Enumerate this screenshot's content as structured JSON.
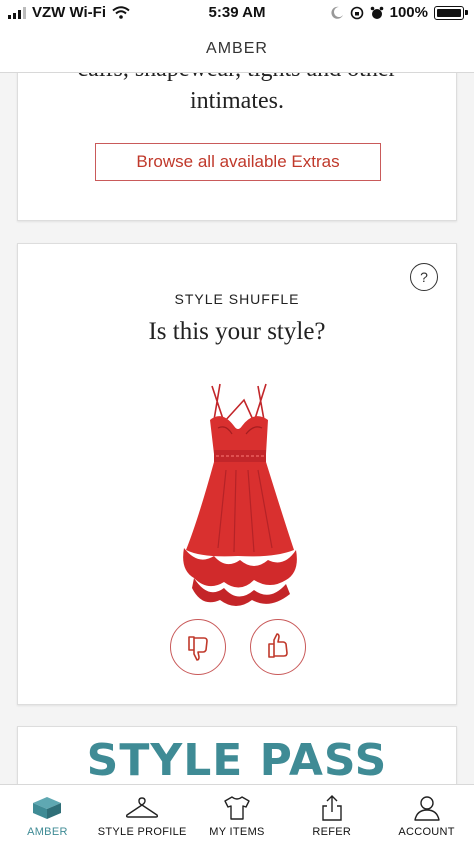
{
  "status_bar": {
    "carrier": "VZW Wi-Fi",
    "time": "5:39 AM",
    "battery": "100%"
  },
  "header": {
    "title": "AMBER"
  },
  "extras_card": {
    "text_line1": "calfs, shapewear, tights and other",
    "text_line2": "intimates.",
    "browse_label": "Browse all available Extras"
  },
  "style_shuffle": {
    "help_label": "?",
    "kicker": "STYLE SHUFFLE",
    "question": "Is this your style?",
    "item_icon": "red-dress-image"
  },
  "style_pass": {
    "title": "STYLE PASS"
  },
  "tabs": [
    {
      "label": "AMBER",
      "icon": "box-icon",
      "active": true
    },
    {
      "label": "STYLE PROFILE",
      "icon": "hanger-icon",
      "active": false
    },
    {
      "label": "MY ITEMS",
      "icon": "shirt-icon",
      "active": false
    },
    {
      "label": "REFER",
      "icon": "share-icon",
      "active": false
    },
    {
      "label": "ACCOUNT",
      "icon": "person-icon",
      "active": false
    }
  ],
  "colors": {
    "accent": "#3f8b95",
    "brand_red": "#c0392b",
    "dress_red": "#d9302f"
  }
}
